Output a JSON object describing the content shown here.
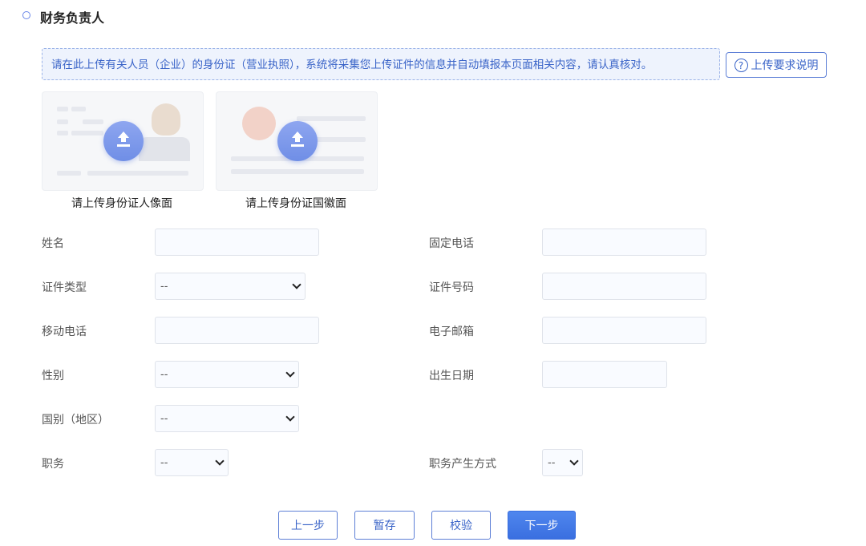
{
  "section": {
    "title": "财务负责人"
  },
  "notice": {
    "text": "请在此上传有关人员（企业）的身份证（营业执照），系统将采集您上传证件的信息并自动填报本页面相关内容，请认真核对。"
  },
  "help": {
    "label": "上传要求说明",
    "icon_text": "?"
  },
  "uploads": [
    {
      "caption": "请上传身份证人像面"
    },
    {
      "caption": "请上传身份证国徽面"
    }
  ],
  "form": {
    "name_label": "姓名",
    "landline_label": "固定电话",
    "id_type_label": "证件类型",
    "id_type_value": "--",
    "id_number_label": "证件号码",
    "mobile_label": "移动电话",
    "email_label": "电子邮箱",
    "gender_label": "性别",
    "gender_value": "--",
    "birth_label": "出生日期",
    "nationality_label": "国别（地区）",
    "nationality_value": "--",
    "position_label": "职务",
    "position_value": "--",
    "appointment_label": "职务产生方式",
    "appointment_value": "--"
  },
  "buttons": {
    "prev": "上一步",
    "save": "暂存",
    "verify": "校验",
    "next": "下一步"
  },
  "colors": {
    "accent": "#3a64c8",
    "primary_button": "#3a6fe0",
    "notice_bg": "#eef3fd"
  }
}
